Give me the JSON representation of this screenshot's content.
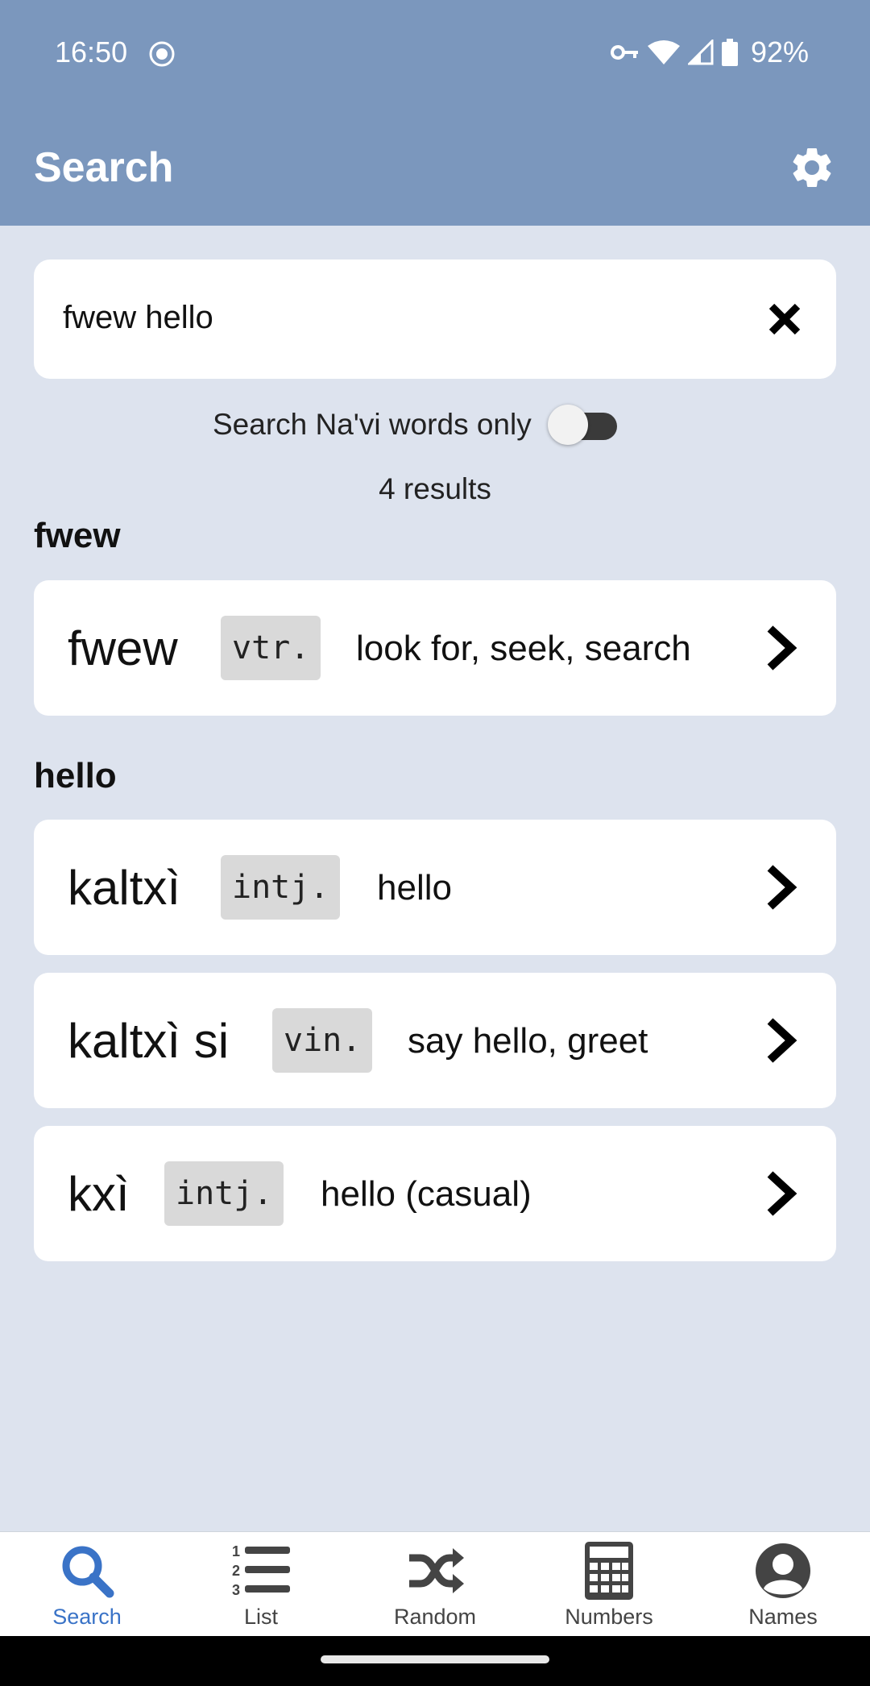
{
  "status_bar": {
    "time": "16:50",
    "battery": "92%",
    "icons": [
      "dnd-icon",
      "vpn-key-icon",
      "wifi-icon",
      "signal-icon",
      "battery-icon"
    ]
  },
  "app_bar": {
    "title": "Search",
    "settings_icon": "gear-icon",
    "color": "#7b97bd"
  },
  "search": {
    "value": "fwew hello",
    "clear_icon": "close-icon"
  },
  "toggle": {
    "label": "Search Na'vi words only",
    "on": false
  },
  "results_count": "4 results",
  "sections": [
    {
      "heading": "fwew",
      "entries": [
        {
          "word": "fwew",
          "pos": "vtr.",
          "gloss": "look for, seek, search"
        }
      ]
    },
    {
      "heading": "hello",
      "entries": [
        {
          "word": "kaltxì",
          "pos": "intj.",
          "gloss": "hello"
        },
        {
          "word": "kaltxì si",
          "pos": "vin.",
          "gloss": "say hello, greet"
        },
        {
          "word": "kxì",
          "pos": "intj.",
          "gloss": "hello (casual)"
        }
      ]
    }
  ],
  "bottom_nav": {
    "active": "Search",
    "active_color": "#3a73c7",
    "items": [
      {
        "label": "Search",
        "icon": "search-icon"
      },
      {
        "label": "List",
        "icon": "list-icon"
      },
      {
        "label": "Random",
        "icon": "shuffle-icon"
      },
      {
        "label": "Numbers",
        "icon": "calculator-icon"
      },
      {
        "label": "Names",
        "icon": "account-icon"
      }
    ]
  }
}
